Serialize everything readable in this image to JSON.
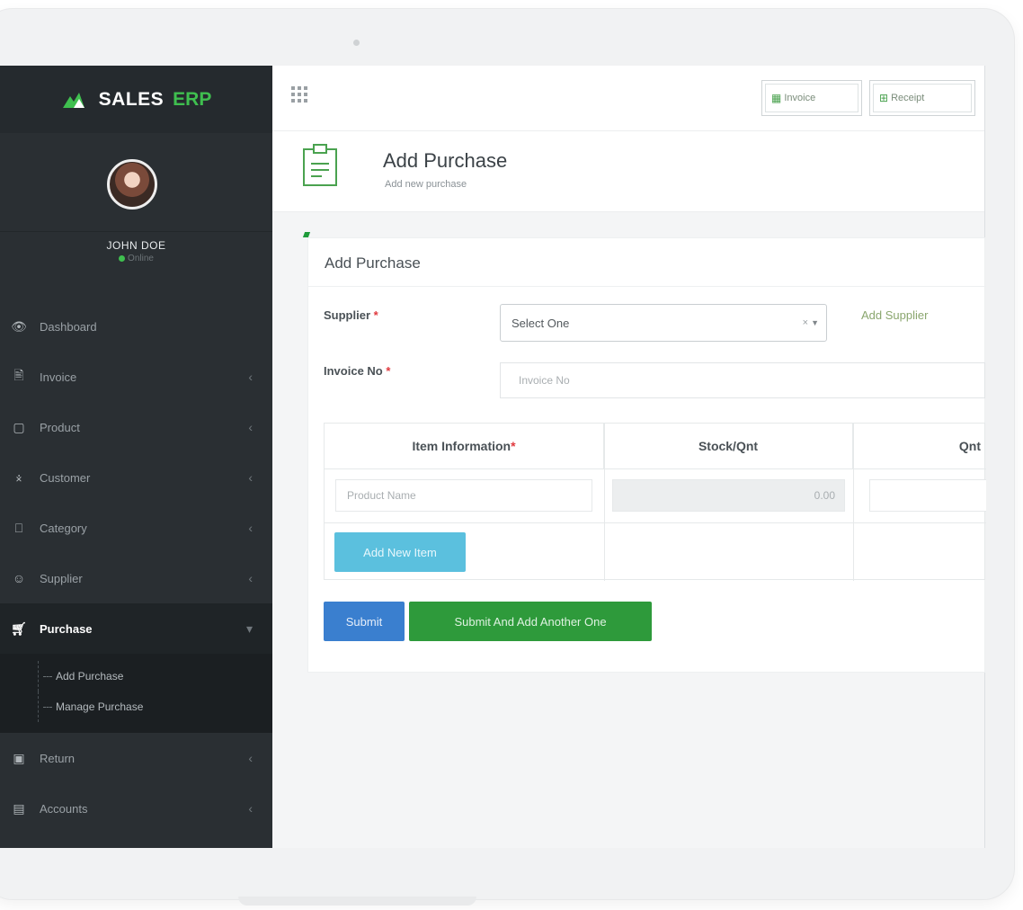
{
  "brand": {
    "name": "SALES",
    "suffix": "ERP"
  },
  "user": {
    "name": "JOHN DOE",
    "status": "Online"
  },
  "sidebar": {
    "items": [
      {
        "label": "Dashboard",
        "icon": "eye-icon",
        "has_arrow": false
      },
      {
        "label": "Invoice",
        "icon": "invoice-icon",
        "has_arrow": true
      },
      {
        "label": "Product",
        "icon": "bag-icon",
        "has_arrow": true
      },
      {
        "label": "Customer",
        "icon": "handshake-icon",
        "has_arrow": true
      },
      {
        "label": "Category",
        "icon": "tag-icon",
        "has_arrow": true
      },
      {
        "label": "Supplier",
        "icon": "users-icon",
        "has_arrow": true
      },
      {
        "label": "Purchase",
        "icon": "cart-icon",
        "has_arrow": true,
        "active": true
      },
      {
        "label": "Return",
        "icon": "return-icon",
        "has_arrow": true
      },
      {
        "label": "Accounts",
        "icon": "accounts-icon",
        "has_arrow": true
      }
    ],
    "purchase_sub": [
      "Add Purchase",
      "Manage Purchase"
    ]
  },
  "topbar": {
    "invoice_label": "Invoice",
    "receipt_label": "Receipt"
  },
  "page": {
    "title": "Add Purchase",
    "subtitle": "Add new purchase"
  },
  "panel": {
    "title": "Add Purchase"
  },
  "form": {
    "supplier_label": "Supplier",
    "supplier_value": "Select One",
    "add_supplier": "Add Supplier",
    "invoice_label": "Invoice No",
    "invoice_placeholder": "Invoice No"
  },
  "table": {
    "headers": [
      "Item Information",
      "Stock/Qnt",
      "Qnt"
    ],
    "product_placeholder": "Product Name",
    "stock_value": "0.00",
    "add_item": "Add New Item"
  },
  "actions": {
    "submit": "Submit",
    "submit_another": "Submit And Add Another One"
  },
  "colors": {
    "sidebar": "#2a2f33",
    "accent_green": "#2e9a3b",
    "accent_blue": "#3a7fcf",
    "accent_info": "#5bc0de"
  }
}
